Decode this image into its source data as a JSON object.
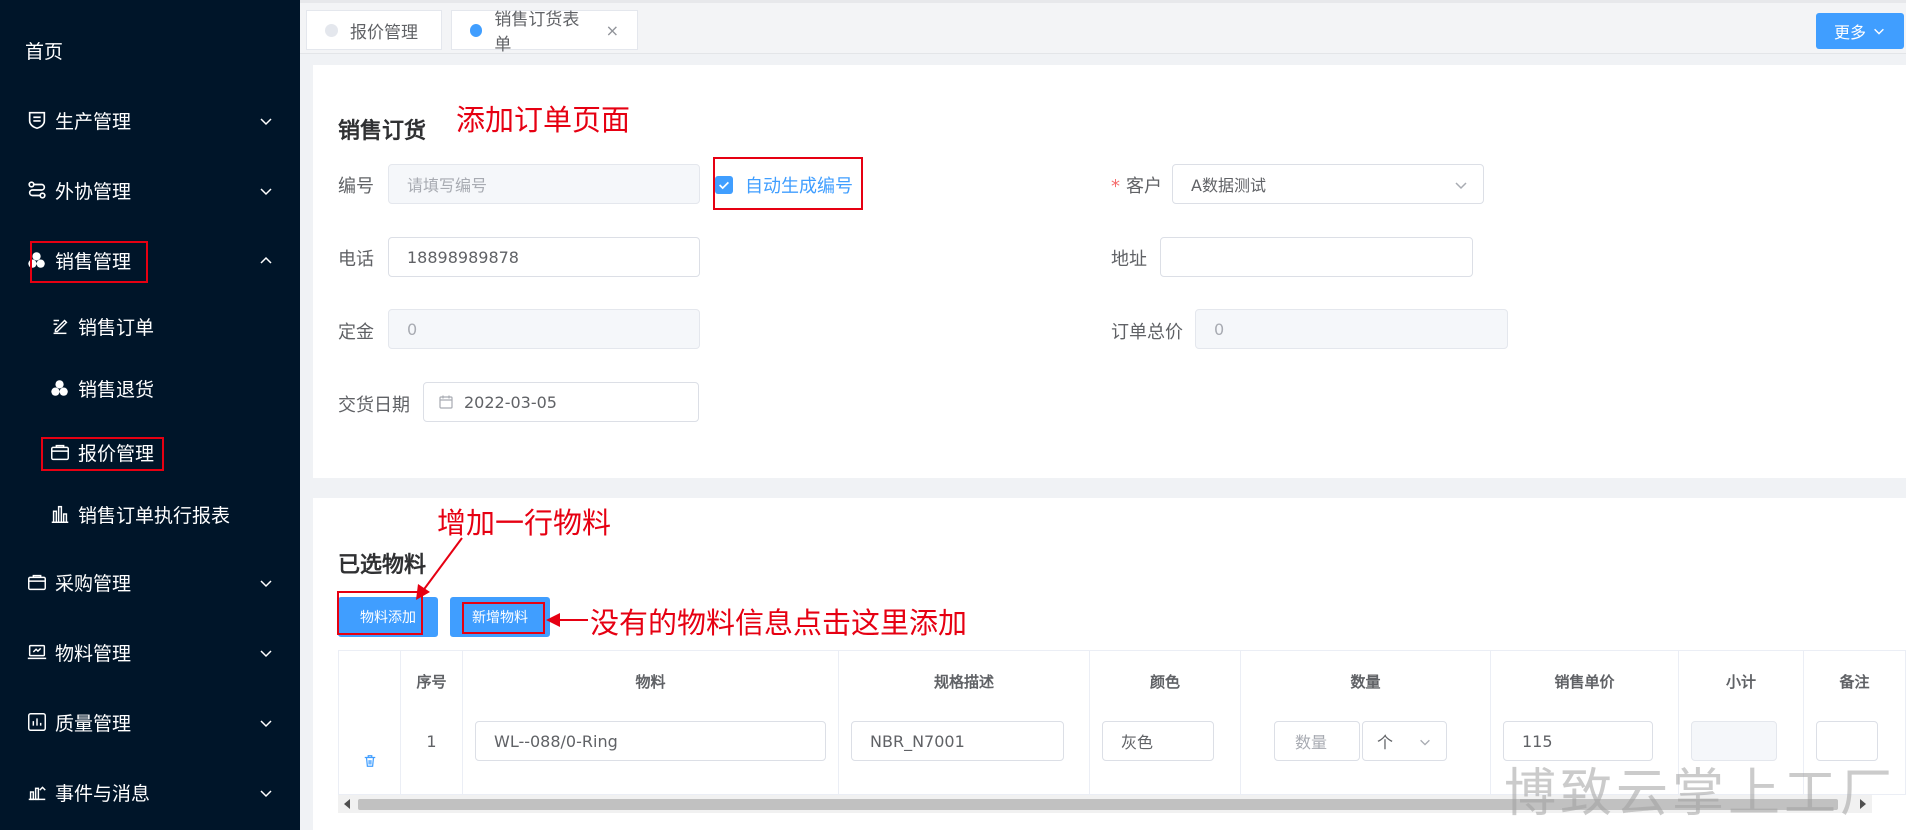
{
  "sidebar": {
    "home": "首页",
    "items": [
      {
        "label": "生产管理",
        "icon": "shield-icon"
      },
      {
        "label": "外协管理",
        "icon": "route-icon"
      },
      {
        "label": "销售管理",
        "icon": "coins-icon"
      },
      {
        "label": "采购管理",
        "icon": "bag-icon"
      },
      {
        "label": "物料管理",
        "icon": "laptop-icon"
      },
      {
        "label": "质量管理",
        "icon": "bar-chart-icon"
      },
      {
        "label": "事件与消息",
        "icon": "stats-icon"
      }
    ],
    "sales_sub": [
      {
        "label": "销售订单",
        "icon": "edit-list-icon"
      },
      {
        "label": "销售退货",
        "icon": "coins-icon"
      },
      {
        "label": "报价管理",
        "icon": "bag-icon"
      },
      {
        "label": "销售订单执行报表",
        "icon": "column-chart-icon"
      }
    ]
  },
  "tabs": [
    {
      "label": "报价管理",
      "active": false
    },
    {
      "label": "销售订货表单",
      "active": true
    }
  ],
  "more_button": "更多",
  "form": {
    "title": "销售订货",
    "code_label": "编号",
    "code_placeholder": "请填写编号",
    "auto_code_label": "自动生成编号",
    "auto_code_checked": true,
    "customer_label": "客户",
    "customer_value": "A数据测试",
    "phone_label": "电话",
    "phone_value": "18898989878",
    "address_label": "地址",
    "address_value": "",
    "deposit_label": "定金",
    "deposit_value": "0",
    "total_label": "订单总价",
    "total_value": "0",
    "delivery_label": "交货日期",
    "delivery_value": "2022-03-05"
  },
  "materials": {
    "title": "已选物料",
    "add_button": "物料添加",
    "new_button": "新增物料",
    "columns": [
      "序号",
      "物料",
      "规格描述",
      "颜色",
      "数量",
      "销售单价",
      "小计",
      "备注"
    ],
    "rows": [
      {
        "index": "1",
        "material": "WL--088/0-Ring",
        "spec": "NBR_N7001",
        "color": "灰色",
        "quantity_placeholder": "数量",
        "unit": "个",
        "price": "115",
        "subtotal": "",
        "remark": ""
      }
    ]
  },
  "annotations": {
    "page_note": "添加订单页面",
    "add_row_note": "增加一行物料",
    "new_material_note": "没有的物料信息点击这里添加"
  },
  "watermark": "博致云掌上工厂",
  "colors": {
    "sidebar_bg": "#001529",
    "primary": "#409eff",
    "annotation_red": "#e60012"
  }
}
